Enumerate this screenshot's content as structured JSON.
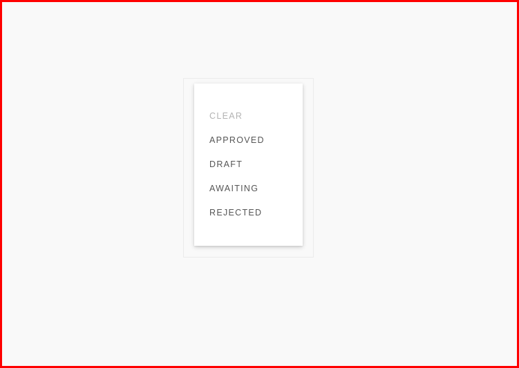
{
  "menu": {
    "items": [
      {
        "label": "CLEAR"
      },
      {
        "label": "APPROVED"
      },
      {
        "label": "DRAFT"
      },
      {
        "label": "AWAITING"
      },
      {
        "label": "REJECTED"
      }
    ]
  },
  "colors": {
    "frame_border": "#ff0000",
    "background": "#f9f9f9",
    "panel": "#ffffff",
    "item_text": "#555555",
    "clear_text": "#b3b3b3"
  }
}
